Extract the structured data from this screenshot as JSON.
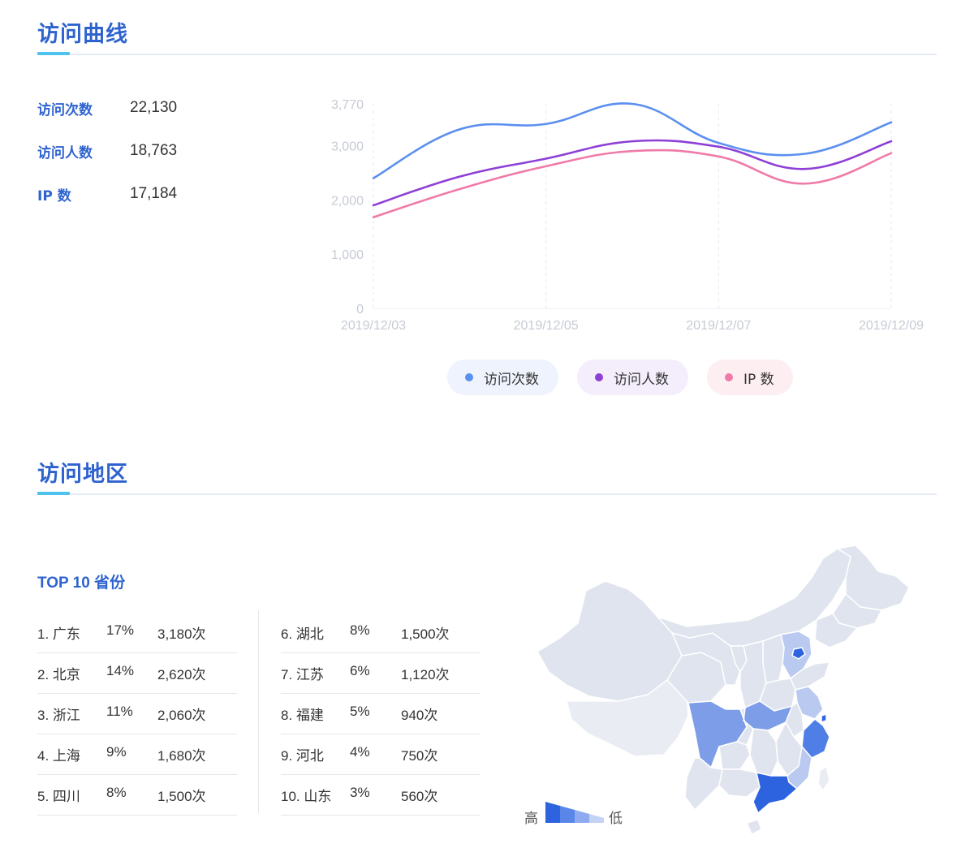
{
  "sections": {
    "visits_title": "访问曲线",
    "region_title": "访问地区"
  },
  "stats": [
    {
      "label": "访问次数",
      "value": "22,130"
    },
    {
      "label": "访问人数",
      "value": "18,763"
    },
    {
      "label": "IP 数",
      "value": "17,184"
    }
  ],
  "chart_data": {
    "type": "line",
    "x": [
      "2019/12/03",
      "2019/12/04",
      "2019/12/05",
      "2019/12/06",
      "2019/12/07",
      "2019/12/08",
      "2019/12/09"
    ],
    "x_ticks": [
      "2019/12/03",
      "2019/12/05",
      "2019/12/07",
      "2019/12/09"
    ],
    "y_ticks": [
      "0",
      "1,000",
      "2,000",
      "3,000",
      "3,770"
    ],
    "ylim": [
      0,
      3770
    ],
    "grid": "vertical dashed",
    "legend_position": "bottom",
    "series": [
      {
        "name": "访问次数",
        "color": "#5b8ff0",
        "values": [
          2400,
          3300,
          3400,
          3770,
          3050,
          2850,
          3430
        ]
      },
      {
        "name": "访问人数",
        "color": "#8e3fd6",
        "values": [
          1900,
          2430,
          2760,
          3080,
          2980,
          2570,
          3080
        ]
      },
      {
        "name": "IP 数",
        "color": "#f07aa8",
        "values": [
          1680,
          2200,
          2620,
          2900,
          2800,
          2300,
          2860
        ]
      }
    ]
  },
  "legend": [
    {
      "label": "访问次数",
      "color": "#5b8ff0",
      "bg": "#eef3fd"
    },
    {
      "label": "访问人数",
      "color": "#8e3fd6",
      "bg": "#f4eefc"
    },
    {
      "label": "IP 数",
      "color": "#f07aa8",
      "bg": "#fdeef2"
    }
  ],
  "top10": {
    "title": "TOP 10 省份",
    "rows": [
      {
        "rank": "1. 广东",
        "pct": "17%",
        "count": "3,180次"
      },
      {
        "rank": "2. 北京",
        "pct": "14%",
        "count": "2,620次"
      },
      {
        "rank": "3. 浙江",
        "pct": "11%",
        "count": "2,060次"
      },
      {
        "rank": "4. 上海",
        "pct": "9%",
        "count": "1,680次"
      },
      {
        "rank": "5. 四川",
        "pct": "8%",
        "count": "1,500次"
      },
      {
        "rank": "6. 湖北",
        "pct": "8%",
        "count": "1,500次"
      },
      {
        "rank": "7. 江苏",
        "pct": "6%",
        "count": "1,120次"
      },
      {
        "rank": "8. 福建",
        "pct": "5%",
        "count": "940次"
      },
      {
        "rank": "9. 河北",
        "pct": "4%",
        "count": "750次"
      },
      {
        "rank": "10. 山东",
        "pct": "3%",
        "count": "560次"
      }
    ]
  },
  "map_scale": {
    "high": "高",
    "low": "低"
  },
  "map_colors": {
    "high": "#2e63e0",
    "mid": "#7d9de8",
    "low": "#b9c9ef",
    "base": "#dfe4ee",
    "light": "#e9ecf2"
  }
}
